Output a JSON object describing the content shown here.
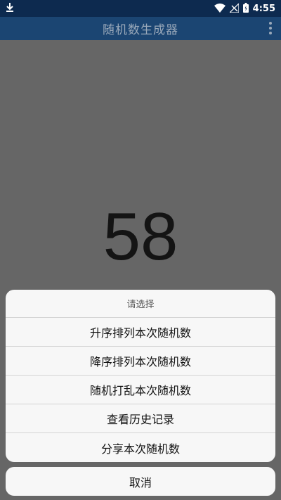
{
  "status_bar": {
    "time": "4:55",
    "icons": [
      "download-icon",
      "wifi-icon",
      "signal-icon",
      "battery-icon"
    ]
  },
  "app_bar": {
    "title": "随机数生成器",
    "menu_icon": "overflow-menu-icon"
  },
  "main": {
    "number": "58"
  },
  "action_sheet": {
    "title": "请选择",
    "items": [
      {
        "label": "升序排列本次随机数"
      },
      {
        "label": "降序排列本次随机数"
      },
      {
        "label": "随机打乱本次随机数"
      },
      {
        "label": "查看历史记录"
      },
      {
        "label": "分享本次随机数"
      }
    ],
    "cancel_label": "取消"
  },
  "colors": {
    "status_bar": "#0d2a4f",
    "app_bar": "#1b4572",
    "overlay": "rgba(0,0,0,0.6)",
    "sheet_bg": "#f7f7f7"
  }
}
